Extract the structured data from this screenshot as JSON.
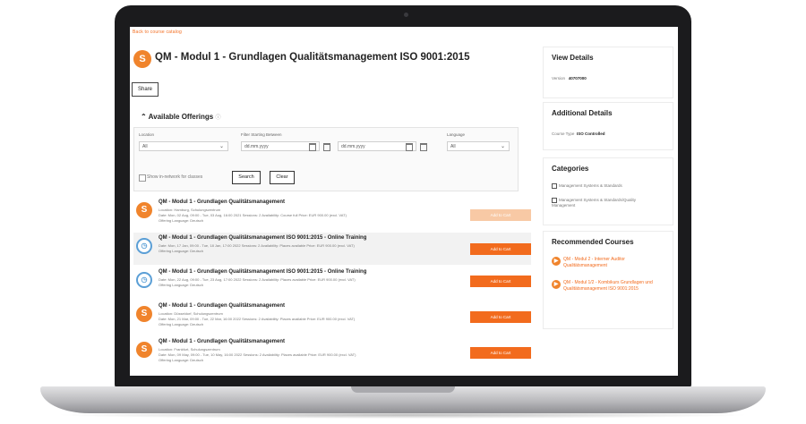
{
  "page": {
    "back_link": "Back to course catalog",
    "title": "QM - Modul 1 - Grundlagen Qualitätsmanagement ISO 9001:2015",
    "share_label": "Share",
    "offerings_header": "Available Offerings",
    "accent": "#f26b1d"
  },
  "filters": {
    "location_label": "Location",
    "location_value": "All",
    "date_label": "Filter Starting Between",
    "date_from_placeholder": "dd.mm.yyyy",
    "date_to_placeholder": "dd.mm.yyyy",
    "language_label": "Language",
    "language_value": "All",
    "checkbox_label": "Show in-network for classes",
    "search_label": "Search",
    "clear_label": "Clear"
  },
  "offerings": [
    {
      "title": "QM - Modul 1 - Grundlagen Qualitätsmanagement",
      "line1": "Location: Hamburg, Schulungszentrum",
      "line2": "Date: Mon, 02 Aug, 09:00 - Tue, 03 Aug, 16:00 2021   Sessions: 2   Availability: Course full   Price: EUR 900.00 (excl. VAT)",
      "line3": "Offering Language: Deutsch",
      "button": "Add to Cart",
      "icon": "sunrise-icon",
      "disabled": true
    },
    {
      "title": "QM - Modul 1 - Grundlagen Qualitätsmanagement ISO 9001:2015 - Online Training",
      "line1": "Date: Mon, 17 Jan, 09:00 - Tue, 18 Jan, 17:00 2022   Sessions: 2   Availability: Places available   Price: EUR 900.00 (excl. VAT)",
      "line2": "Offering Language: Deutsch",
      "line3": "",
      "button": "Add to Cart",
      "icon": "clock-icon",
      "disabled": false
    },
    {
      "title": "QM - Modul 1 - Grundlagen Qualitätsmanagement ISO 9001:2015 - Online Training",
      "line1": "Date: Mon, 22 Aug, 09:00 - Tue, 23 Aug, 17:00 2022   Sessions: 2   Availability: Places available   Price: EUR 900.00 (excl. VAT)",
      "line2": "Offering Language: Deutsch",
      "line3": "",
      "button": "Add to Cart",
      "icon": "clock-icon",
      "disabled": false
    },
    {
      "title": "QM - Modul 1 - Grundlagen Qualitätsmanagement",
      "line1": "Location: Düsseldorf, Schulungszentrum",
      "line2": "Date: Mon, 21 Mar, 09:00 - Tue, 22 Mar, 16:00 2022   Sessions: 2   Availability: Places available   Price: EUR 900.00 (excl. VAT)",
      "line3": "Offering Language: Deutsch",
      "button": "Add to Cart",
      "icon": "sunrise-icon",
      "disabled": false
    },
    {
      "title": "QM - Modul 1 - Grundlagen Qualitätsmanagement",
      "line1": "Location: Frankfurt, Schulungszentrum",
      "line2": "Date: Mon, 09 May, 09:00 - Tue, 10 May, 16:00 2022   Sessions: 2   Availability: Places available   Price: EUR 900.00 (excl. VAT)",
      "line3": "Offering Language: Deutsch",
      "button": "Add to Cart",
      "icon": "sunrise-icon",
      "disabled": false
    }
  ],
  "sidebar": {
    "view_details": {
      "title": "View Details",
      "key": "Version",
      "value": "40707000"
    },
    "additional": {
      "title": "Additional Details",
      "key": "Course Type",
      "value": "ISO Controlled"
    },
    "categories": {
      "title": "Categories",
      "items": [
        "Management Systems & Standards",
        "Management Systems & Standards/Quality Management"
      ]
    },
    "recommended": {
      "title": "Recommended Courses",
      "items": [
        "QM - Modul 2 - Interner Auditor Qualitätsmanagement",
        "QM - Modul 1/2 - Kombikurs Grundlagen und Qualitätsmanagement ISO 9001:2015"
      ]
    }
  }
}
